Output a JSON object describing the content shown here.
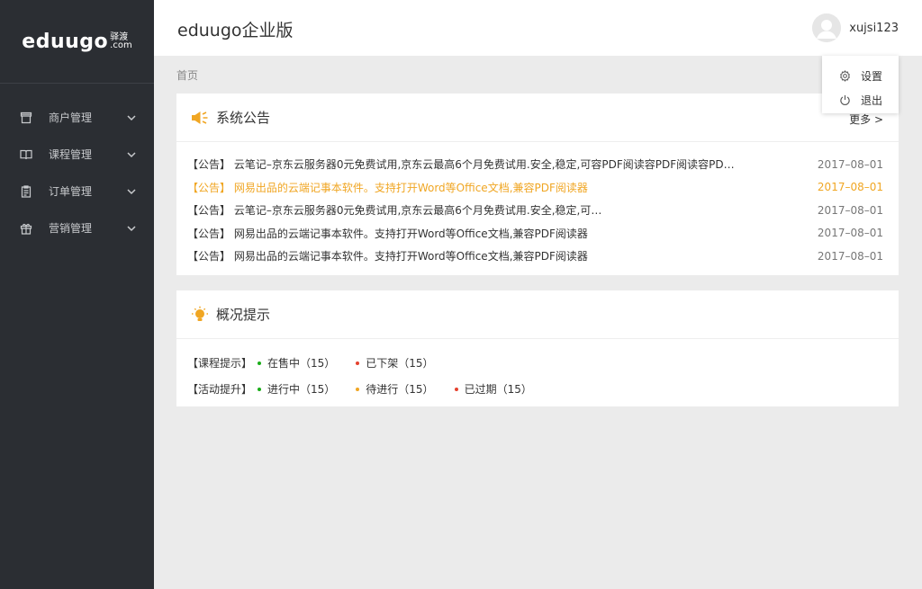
{
  "sidebar": {
    "logo_text": "eduugo",
    "logo_cn": "驿渡",
    "logo_com": ".com",
    "items": [
      {
        "label": "商户管理",
        "icon": "store-icon"
      },
      {
        "label": "课程管理",
        "icon": "book-icon"
      },
      {
        "label": "订单管理",
        "icon": "clipboard-icon"
      },
      {
        "label": "营销管理",
        "icon": "gift-icon"
      }
    ]
  },
  "header": {
    "title": "eduugo企业版",
    "username": "xujsi123"
  },
  "dropdown": {
    "items": [
      {
        "label": "设置",
        "icon": "gear-icon"
      },
      {
        "label": "退出",
        "icon": "power-icon"
      }
    ]
  },
  "breadcrumb": "首页",
  "notices": {
    "title": "系统公告",
    "more": "更多 >",
    "items": [
      {
        "text": "【公告】 云笔记–京东云服务器0元免费试用,京东云最高6个月免费试用.安全,稳定,可容PDF阅读容PDF阅读容PD…",
        "date": "2017–08–01"
      },
      {
        "text": "【公告】 网易出品的云端记事本软件。支持打开Word等Office文档,兼容PDF阅读器",
        "date": "2017–08–01"
      },
      {
        "text": "【公告】 云笔记–京东云服务器0元免费试用,京东云最高6个月免费试用.安全,稳定,可…",
        "date": "2017–08–01"
      },
      {
        "text": "【公告】 网易出品的云端记事本软件。支持打开Word等Office文档,兼容PDF阅读器",
        "date": "2017–08–01"
      },
      {
        "text": "【公告】 网易出品的云端记事本软件。支持打开Word等Office文档,兼容PDF阅读器",
        "date": "2017–08–01"
      }
    ],
    "highlight_color": "#f0a623"
  },
  "overview": {
    "title": "概况提示",
    "rows": [
      {
        "label": "【课程提示】",
        "stats": [
          {
            "text": "在售中（15）",
            "color": "#1aad19"
          },
          {
            "text": "已下架（15）",
            "color": "#e5412e"
          }
        ]
      },
      {
        "label": "【活动提升】",
        "stats": [
          {
            "text": "进行中（15）",
            "color": "#1aad19"
          },
          {
            "text": "待进行（15）",
            "color": "#f0a623"
          },
          {
            "text": "已过期（15）",
            "color": "#e5412e"
          }
        ]
      }
    ]
  },
  "colors": {
    "sidebar_bg": "#2b2e33",
    "accent": "#f0a623",
    "page_bg": "#ebebeb"
  }
}
